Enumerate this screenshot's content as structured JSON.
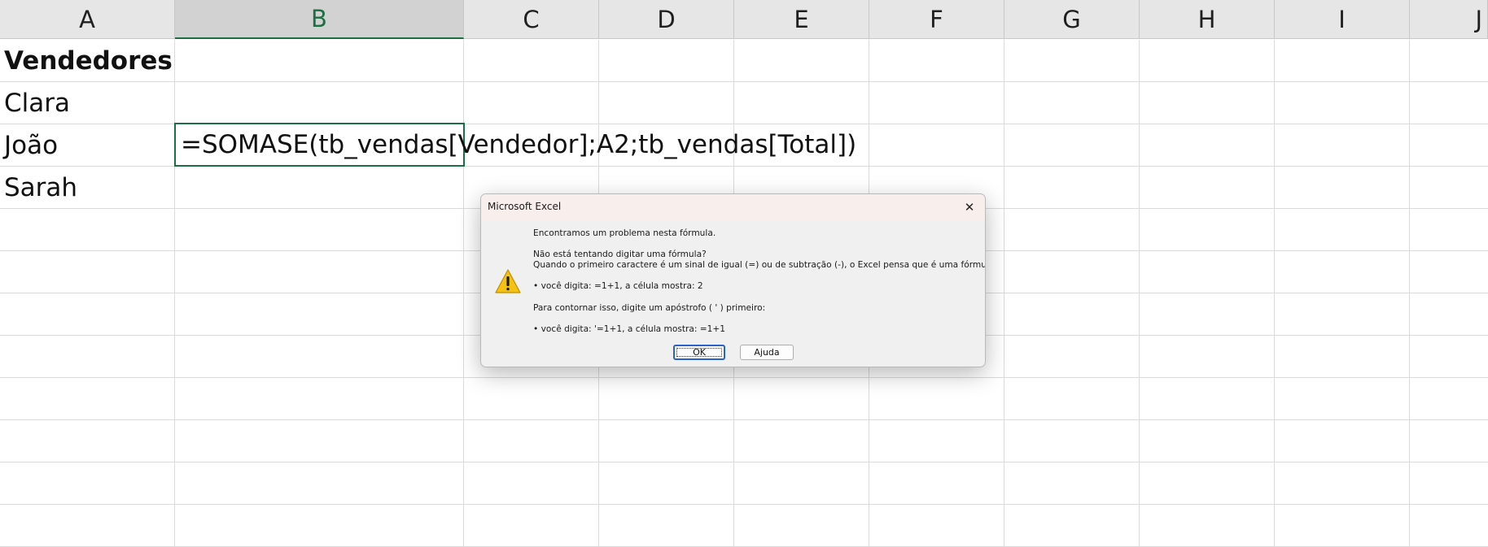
{
  "spreadsheet": {
    "columns": [
      "A",
      "B",
      "C",
      "D",
      "E",
      "F",
      "G",
      "H",
      "I",
      "J"
    ],
    "selected_column": "B",
    "cells": {
      "A1": "Vendedores",
      "A2": "Clara",
      "A3": "João",
      "A4": "Sarah",
      "B3": "=SOMASE(tb_vendas[Vendedor];A2;tb_vendas[Total])"
    }
  },
  "dialog": {
    "title": "Microsoft Excel",
    "close_icon": "close-icon",
    "warning_icon": "warning-icon",
    "lines": [
      "Encontramos um problema nesta fórmula.",
      "Não está tentando digitar uma fórmula?",
      "Quando o primeiro caractere é um sinal de igual (=) ou de subtração (-), o Excel pensa que é uma fórmula:",
      "• você digita:   =1+1, a célula mostra:   2",
      "Para contornar isso, digite um apóstrofo ( ' ) primeiro:",
      "• você digita:   '=1+1, a célula mostra:   =1+1"
    ],
    "ok_label": "OK",
    "help_label": "Ajuda"
  },
  "colors": {
    "selection_accent": "#1e6e43",
    "warning_yellow": "#f5c211"
  }
}
